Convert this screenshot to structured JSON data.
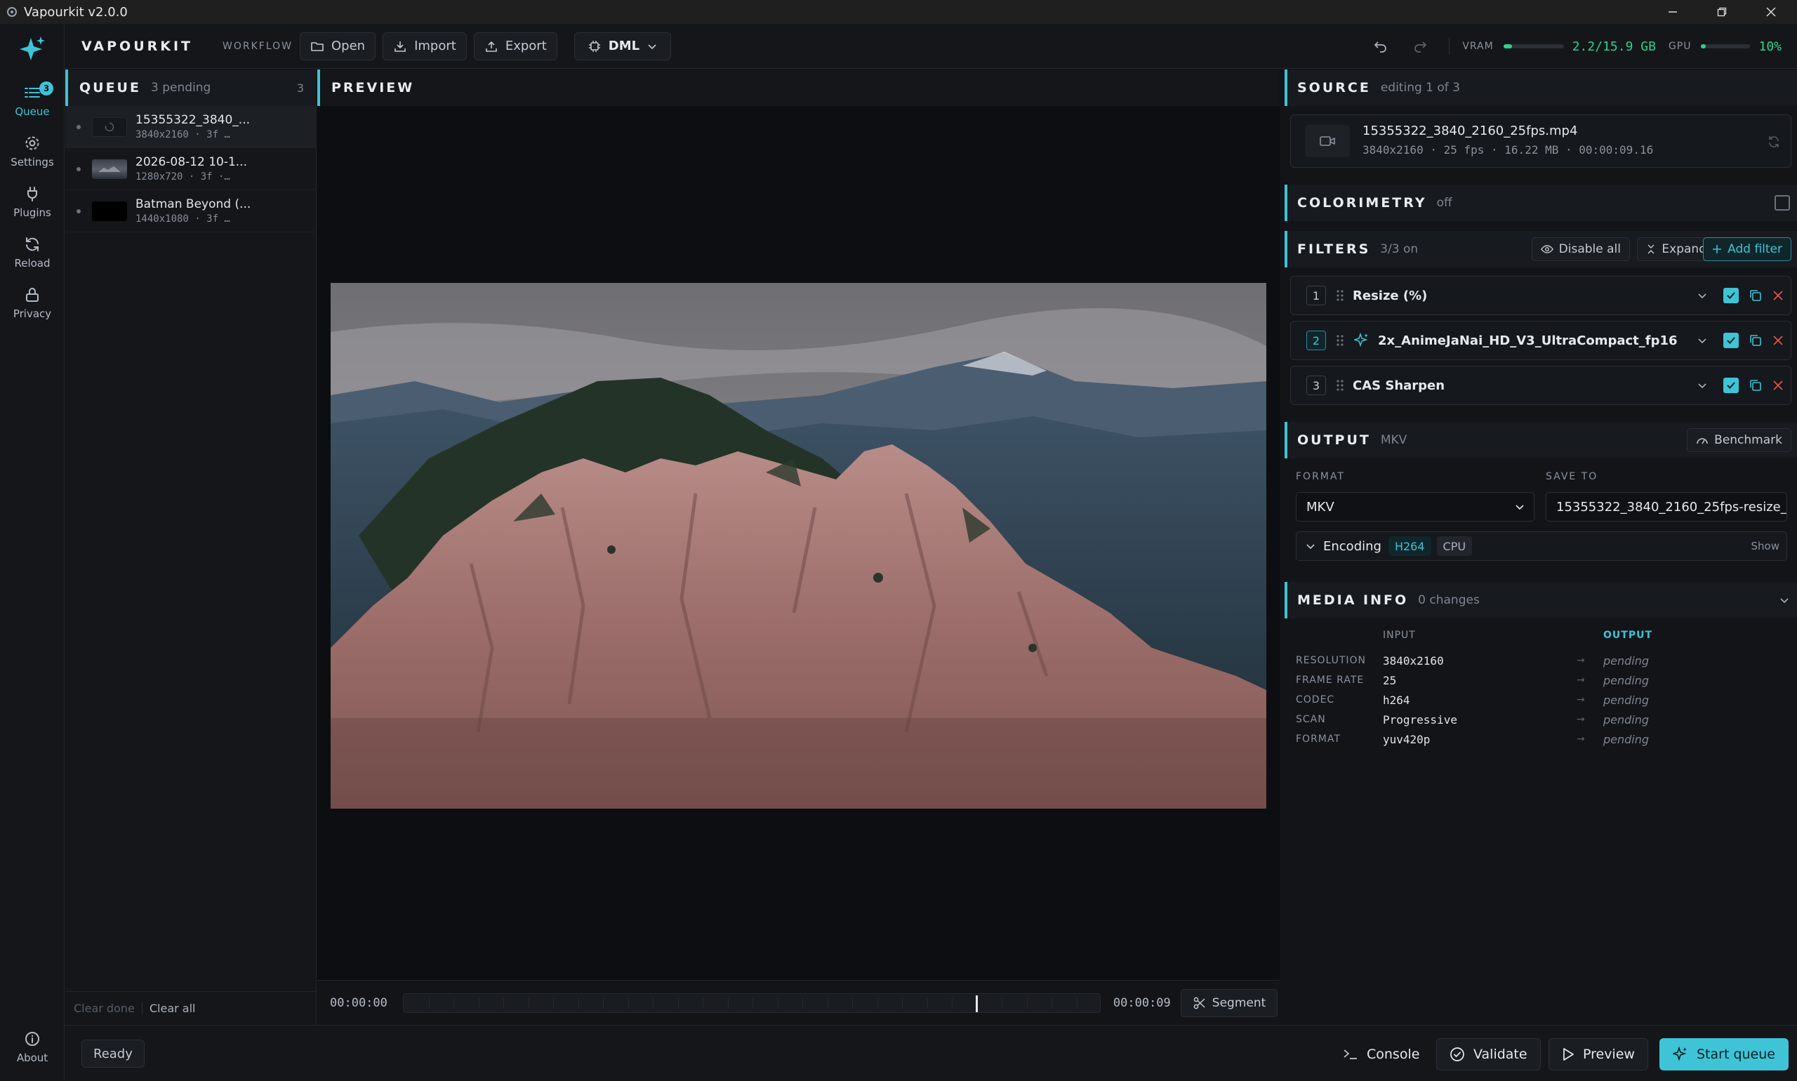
{
  "window": {
    "title": "Vapourkit v2.0.0"
  },
  "rail": {
    "items": [
      {
        "label": "Queue",
        "icon": "list-icon",
        "badge": "3"
      },
      {
        "label": "Settings",
        "icon": "gear-icon"
      },
      {
        "label": "Plugins",
        "icon": "plug-icon"
      },
      {
        "label": "Reload",
        "icon": "reload-icon"
      },
      {
        "label": "Privacy",
        "icon": "lock-icon"
      }
    ],
    "about": "About"
  },
  "toolbar": {
    "brand": "VAPOURKIT",
    "workflow_label": "WORKFLOW",
    "open": "Open",
    "import": "Import",
    "export": "Export",
    "backend": "DML",
    "vram_label": "VRAM",
    "vram_value": "2.2/15.9 GB",
    "vram_fraction": 0.14,
    "gpu_label": "GPU",
    "gpu_value": "10%",
    "gpu_fraction": 0.1
  },
  "queue": {
    "title": "QUEUE",
    "pending": "3 pending",
    "count": "3",
    "items": [
      {
        "name": "15355322_3840_...",
        "meta": "3840x2160 · 3f …"
      },
      {
        "name": "2026-08-12 10-1...",
        "meta": "1280x720 · 3f ·…"
      },
      {
        "name": "Batman Beyond (...",
        "meta": "1440x1080 · 3f …"
      }
    ],
    "clear_done": "Clear done",
    "clear_all": "Clear all"
  },
  "preview": {
    "title": "PREVIEW",
    "time_start": "00:00:00",
    "time_end": "00:00:09",
    "playhead_fraction": 0.82,
    "segment": "Segment"
  },
  "source": {
    "title": "SOURCE",
    "subtitle": "editing 1 of 3",
    "filename": "15355322_3840_2160_25fps.mp4",
    "meta": "3840x2160 · 25 fps · 16.22 MB · 00:00:09.16"
  },
  "colorimetry": {
    "title": "COLORIMETRY",
    "state": "off"
  },
  "filters": {
    "title": "FILTERS",
    "count": "3/3 on",
    "disable_all": "Disable all",
    "expand": "Expand",
    "add_filter": "Add filter",
    "items": [
      {
        "num": "1",
        "name": "Resize (%)"
      },
      {
        "num": "2",
        "name": "2x_AnimeJaNai_HD_V3_UltraCompact_fp16"
      },
      {
        "num": "3",
        "name": "CAS Sharpen"
      }
    ]
  },
  "output": {
    "title": "OUTPUT",
    "container": "MKV",
    "benchmark": "Benchmark",
    "format_label": "FORMAT",
    "format_value": "MKV",
    "save_label": "SAVE TO",
    "save_value": "15355322_3840_2160_25fps-resize_...",
    "encoding_label": "Encoding",
    "codec_tag": "H264",
    "device_tag": "CPU",
    "show": "Show"
  },
  "media_info": {
    "title": "MEDIA INFO",
    "changes": "0 changes",
    "input_header": "INPUT",
    "output_header": "OUTPUT",
    "rows": [
      {
        "key": "RESOLUTION",
        "input": "3840x2160",
        "output": "pending"
      },
      {
        "key": "FRAME RATE",
        "input": "25",
        "output": "pending"
      },
      {
        "key": "CODEC",
        "input": "h264",
        "output": "pending"
      },
      {
        "key": "SCAN",
        "input": "Progressive",
        "output": "pending"
      },
      {
        "key": "FORMAT",
        "input": "yuv420p",
        "output": "pending"
      }
    ]
  },
  "statusbar": {
    "status": "Ready",
    "console": "Console",
    "validate": "Validate",
    "preview": "Preview",
    "start": "Start queue"
  },
  "colors": {
    "accent": "#3fc3d6",
    "meter": "#2ed18a",
    "danger": "#e0524b"
  }
}
